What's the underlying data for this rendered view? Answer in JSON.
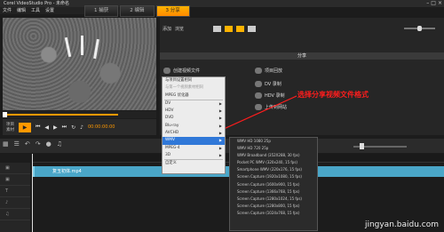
{
  "app": {
    "title": "Corel VideoStudio Pro - 未命名",
    "menu": [
      "文件",
      "编辑",
      "工具",
      "设置"
    ]
  },
  "steps": [
    {
      "label": "1 捕获",
      "active": false
    },
    {
      "label": "2 编辑",
      "active": false
    },
    {
      "label": "3 分享",
      "active": true
    }
  ],
  "player": {
    "project_label": "项目",
    "clip_label": "素材",
    "timecode": "00:00:00:00",
    "bracket_in": "[",
    "bracket_out": "]"
  },
  "share": {
    "toolbar": [
      "添加",
      "浏览"
    ],
    "bar_title": "分享",
    "items": [
      {
        "label": "创建视频文件",
        "icon": "film-icon"
      },
      {
        "label": "项目回放",
        "icon": "playback-icon"
      },
      {
        "label": "DV 录制",
        "icon": "dv-icon"
      },
      {
        "label": "HDV 录制",
        "icon": "hdv-icon"
      },
      {
        "label": "上传到网站",
        "icon": "upload-icon"
      }
    ]
  },
  "dropdown": {
    "items": [
      {
        "label": "与项目设置相同",
        "disabled": false,
        "arrow": false
      },
      {
        "label": "与第一个视频素材相同",
        "disabled": true,
        "arrow": false
      },
      {
        "label": "MPEG 优化器",
        "disabled": false,
        "arrow": false
      },
      {
        "label": "DV",
        "disabled": false,
        "arrow": true
      },
      {
        "label": "HDV",
        "disabled": false,
        "arrow": true
      },
      {
        "label": "DVD",
        "disabled": false,
        "arrow": true
      },
      {
        "label": "Blu-ray",
        "disabled": false,
        "arrow": true
      },
      {
        "label": "AVCHD",
        "disabled": false,
        "arrow": true
      },
      {
        "label": "WMV",
        "disabled": false,
        "arrow": true,
        "highlight": true
      },
      {
        "label": "MPEG-4",
        "disabled": false,
        "arrow": true
      },
      {
        "label": "3D",
        "disabled": false,
        "arrow": true
      },
      {
        "label": "自定义",
        "disabled": false,
        "arrow": false
      }
    ]
  },
  "submenu": {
    "items": [
      "WMV HD 1080 25p",
      "WMV HD 720 25p",
      "WMV Broadband (352X288, 30 fps)",
      "Pocket PC WMV (320x240, 15 fps)",
      "Smartphone WMV (220x176, 15 fps)",
      "Screen Capture (1920x1080, 15 fps)",
      "Screen Capture (1600x900, 15 fps)",
      "Screen Capture (1366x768, 15 fps)",
      "Screen Capture (1280x1024, 15 fps)",
      "Screen Capture (1280x800, 15 fps)",
      "Screen Capture (1024x768, 15 fps)"
    ]
  },
  "annotation": "选择分享视频文件格式",
  "timeline": {
    "clip_name": "复玉初体.mp4"
  },
  "watermark": "jingyan.baidu.com",
  "colors": {
    "accent": "#ff9900",
    "annotation": "#ff1d1d",
    "highlight": "#3078d8",
    "clip": "#4aa6c8"
  }
}
